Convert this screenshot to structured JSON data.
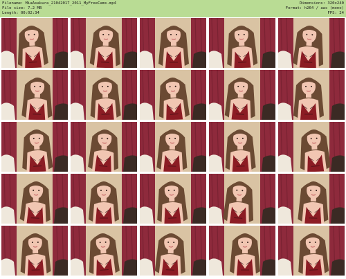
{
  "header": {
    "filename_line": "Filename: MiaAsakura_21042017_2011_MyFreeCams.mp4",
    "filesize_line": "File size: 7.2 MB",
    "length_line": "Length: 00:02:34",
    "dimensions_line": "Dimensions: 320x240",
    "format_line": "Format: h264 / aac (mono)",
    "fps_line": "FPS: 24",
    "background_color": "#b9dc94"
  },
  "thumbnails": {
    "rows": 5,
    "columns": 5,
    "count": 25,
    "timestamps": []
  },
  "colors": {
    "curtain": "#8e2a3c",
    "wall": "#d9c3a3",
    "hair": "#6b4a33",
    "skin": "#f1c6b2",
    "top": "#8c1c24"
  }
}
